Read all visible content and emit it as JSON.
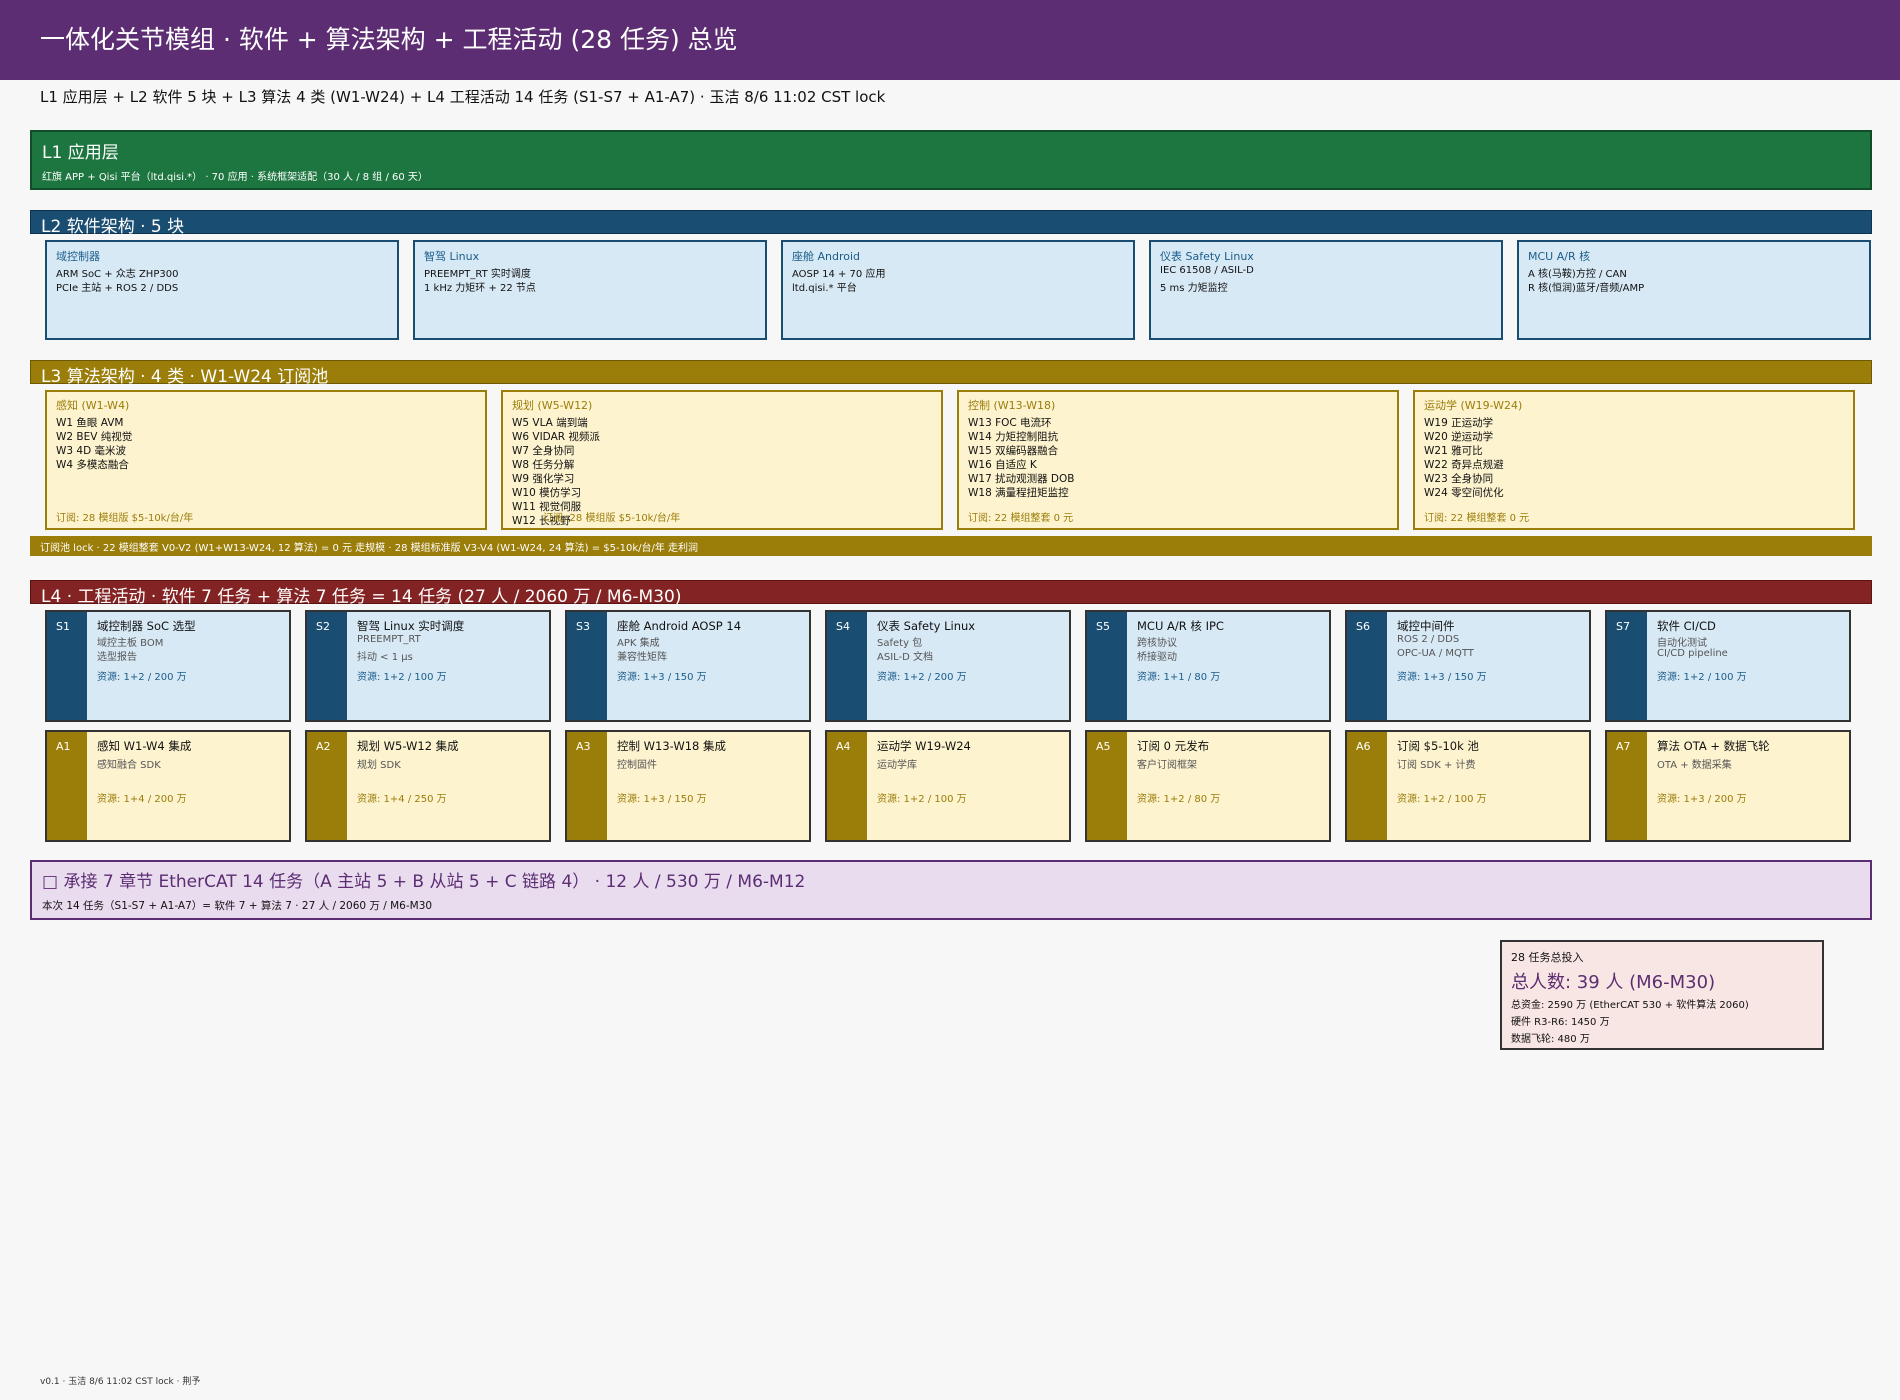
{
  "header": {
    "title": "一体化关节模组 ·  软件 + 算法架构 + 工程活动 (28 任务) 总览",
    "subtitle": "L1 应用层 + L2 软件 5 块 + L3 算法 4 类 (W1-W24) + L4 工程活动 14 任务 (S1-S7 + A1-A7) ·  玉洁 8/6 11:02 CST lock"
  },
  "l1": {
    "title": "L1 应用层",
    "sub": "红旗 APP + Qisi 平台（ltd.qisi.*） ·  70 应用 ·  系统框架适配（30 人 / 8 组 / 60 天）"
  },
  "l2": {
    "title": "L2 软件架构 ·  5 块",
    "blocks": [
      {
        "name": "域控制器",
        "lines": [
          "ARM SoC + 众志 ZHP300",
          "PCIe 主站 + ROS 2 / DDS"
        ]
      },
      {
        "name": "智驾 Linux",
        "lines": [
          "PREEMPT_RT 实时调度",
          "1 kHz 力矩环 + 22 节点"
        ]
      },
      {
        "name": "座舱 Android",
        "lines": [
          "AOSP 14 + 70 应用",
          "ltd.qisi.* 平台"
        ]
      },
      {
        "name": "仪表 Safety Linux",
        "lines": [
          "IEC 61508 / ASIL-D",
          "5 ms 力矩监控"
        ]
      },
      {
        "name": "MCU A/R 核",
        "lines": [
          "A 核(马鞍)方控 / CAN",
          "R 核(恒润)蓝牙/音频/AMP"
        ]
      }
    ]
  },
  "l3": {
    "title": "L3 算法架构 ·  4 类 ·  W1-W24 订阅池",
    "categories": [
      {
        "name": "感知 (W1-W4)",
        "items": [
          "W1 鱼眼 AVM",
          "W2 BEV 纯视觉",
          "W3 4D 毫米波",
          "W4 多模态融合"
        ],
        "footer": "订阅: 28 模组版 $5-10k/台/年"
      },
      {
        "name": "规划 (W5-W12)",
        "items": [
          "W5 VLA 端到端",
          "W6 VIDAR 视频派",
          "W7 全身协同",
          "W8 任务分解",
          "W9 强化学习",
          "W10 模仿学习",
          "W11 视觉伺服",
          "W12 长视野"
        ],
        "footer": "订阅: 28 模组版 $5-10k/台/年"
      },
      {
        "name": "控制 (W13-W18)",
        "items": [
          "W13 FOC 电流环",
          "W14 力矩控制阻抗",
          "W15 双编码器融合",
          "W16 自适应 K",
          "W17 扰动观测器 DOB",
          "W18 满量程扭矩监控"
        ],
        "footer": "订阅: 22 模组整套 0 元"
      },
      {
        "name": "运动学 (W19-W24)",
        "items": [
          "W19 正运动学",
          "W20 逆运动学",
          "W21 雅可比",
          "W22 奇异点规避",
          "W23 全身协同",
          "W24 零空间优化"
        ],
        "footer": "订阅: 22 模组整套 0 元"
      }
    ],
    "pool_lock": "订阅池 lock ·  22 模组整套 V0-V2 (W1+W13-W24, 12 算法) = 0 元 走规模 ·  28 模组标准版 V3-V4 (W1-W24, 24 算法) = $5-10k/台/年 走利润"
  },
  "l4": {
    "title": "L4 ·  工程活动 ·  软件 7 任务 + 算法 7 任务 = 14 任务 (27 人 / 2060 万 / M6-M30)",
    "software_tasks": [
      {
        "id": "S1",
        "title": "域控制器 SoC 选型",
        "desc": [
          "域控主板 BOM",
          "选型报告"
        ],
        "res": "资源: 1+2 / 200 万"
      },
      {
        "id": "S2",
        "title": "智驾 Linux 实时调度",
        "desc": [
          "PREEMPT_RT",
          "抖动 < 1 μs"
        ],
        "res": "资源: 1+2 / 100 万"
      },
      {
        "id": "S3",
        "title": "座舱 Android AOSP 14",
        "desc": [
          "APK 集成",
          "兼容性矩阵"
        ],
        "res": "资源: 1+3 / 150 万"
      },
      {
        "id": "S4",
        "title": "仪表 Safety Linux",
        "desc": [
          "Safety 包",
          "ASIL-D 文档"
        ],
        "res": "资源: 1+2 / 200 万"
      },
      {
        "id": "S5",
        "title": "MCU A/R 核 IPC",
        "desc": [
          "跨核协议",
          "桥接驱动"
        ],
        "res": "资源: 1+1 / 80 万"
      },
      {
        "id": "S6",
        "title": "域控中间件",
        "desc": [
          "ROS 2 / DDS",
          "OPC-UA / MQTT"
        ],
        "res": "资源: 1+3 / 150 万"
      },
      {
        "id": "S7",
        "title": "软件 CI/CD",
        "desc": [
          "自动化测试",
          "CI/CD pipeline"
        ],
        "res": "资源: 1+2 / 100 万"
      }
    ],
    "algorithm_tasks": [
      {
        "id": "A1",
        "title": "感知 W1-W4 集成",
        "desc": [
          "感知融合 SDK"
        ],
        "res": "资源: 1+4 / 200 万"
      },
      {
        "id": "A2",
        "title": "规划 W5-W12 集成",
        "desc": [
          "规划 SDK"
        ],
        "res": "资源: 1+4 / 250 万"
      },
      {
        "id": "A3",
        "title": "控制 W13-W18 集成",
        "desc": [
          "控制固件"
        ],
        "res": "资源: 1+3 / 150 万"
      },
      {
        "id": "A4",
        "title": "运动学 W19-W24",
        "desc": [
          "运动学库"
        ],
        "res": "资源: 1+2 / 100 万"
      },
      {
        "id": "A5",
        "title": "订阅 0 元发布",
        "desc": [
          "客户订阅框架"
        ],
        "res": "资源: 1+2 / 80 万"
      },
      {
        "id": "A6",
        "title": "订阅 $5-10k 池",
        "desc": [
          "订阅 SDK + 计费"
        ],
        "res": "资源: 1+2 / 100 万"
      },
      {
        "id": "A7",
        "title": "算法 OTA + 数据飞轮",
        "desc": [
          "OTA + 数据采集"
        ],
        "res": "资源: 1+3 / 200 万"
      }
    ]
  },
  "ethercat": {
    "title": "□  承接 7 章节 EtherCAT 14 任务（A 主站 5 + B 从站 5 + C 链路 4） ·  12 人 / 530 万 / M6-M12",
    "sub": "本次 14 任务（S1-S7 + A1-A7）= 软件 7 + 算法 7 ·  27 人 / 2060 万 / M6-M30"
  },
  "summary": {
    "label": "28 任务总投入",
    "headline": "总人数: 39 人 (M6-M30)",
    "lines": [
      "总资金: 2590 万 (EtherCAT 530 + 软件算法 2060)",
      "硬件 R3-R6: 1450 万",
      "数据飞轮: 480 万"
    ]
  },
  "footer": "v0.1 ·  玉洁 8/6 11:02 CST lock ·  荆予",
  "colors": {
    "header": "#5c2d72",
    "l1": "#1d7640",
    "l2": "#1a4d72",
    "l3": "#9b7d0a",
    "l4": "#842323",
    "software_fill": "#d8e9f6",
    "algorithm_fill": "#fdf3cf",
    "ethercat_fill": "#e9dcef",
    "summary_fill": "#f8e6e4"
  }
}
